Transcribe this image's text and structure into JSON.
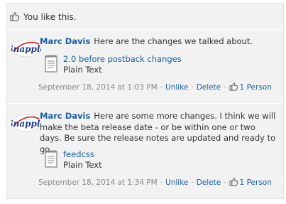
{
  "like_bar": {
    "text": "You like this."
  },
  "comments": [
    {
      "author": "Marc Davis",
      "message": "Here are the changes we talked about.",
      "attachment": {
        "name": "2.0 before postback changes",
        "type": "Plain Text"
      },
      "timestamp": "September 18, 2014 at 1:03 PM",
      "unlike_label": "Unlike",
      "delete_label": "Delete",
      "like_count_a": "1",
      "like_count_b": "Person"
    },
    {
      "author": "Marc Davis",
      "message": "Here are some more changes. I think we will make the beta release date - or be within one or two days. Be sure the release notes are updated and ready to go.",
      "attachment": {
        "name": "feedcss",
        "type": "Plain Text"
      },
      "timestamp": "September 18, 2014 at 1:34 PM",
      "unlike_label": "Unlike",
      "delete_label": "Delete",
      "like_count_a": "1",
      "like_count_b": "Person"
    }
  ],
  "avatar_alt": "Snapple",
  "colors": {
    "link": "#1a5fa8",
    "meta": "#8a8a8a",
    "panel": "#f2f2f2"
  }
}
